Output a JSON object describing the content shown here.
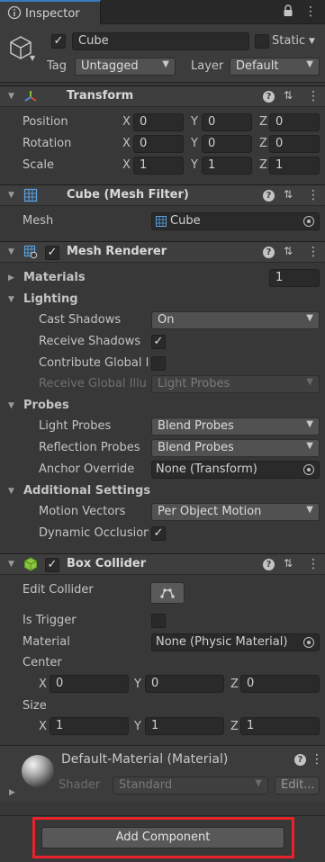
{
  "tab": {
    "title": "Inspector"
  },
  "gameobject": {
    "active": true,
    "name": "Cube",
    "static_label": "Static",
    "static": false,
    "tag_label": "Tag",
    "tag_value": "Untagged",
    "layer_label": "Layer",
    "layer_value": "Default"
  },
  "transform": {
    "title": "Transform",
    "rows": [
      {
        "label": "Position",
        "x": "0",
        "y": "0",
        "z": "0"
      },
      {
        "label": "Rotation",
        "x": "0",
        "y": "0",
        "z": "0"
      },
      {
        "label": "Scale",
        "x": "1",
        "y": "1",
        "z": "1"
      }
    ]
  },
  "mesh_filter": {
    "title": "Cube (Mesh Filter)",
    "mesh_label": "Mesh",
    "mesh_value": "Cube"
  },
  "mesh_renderer": {
    "title": "Mesh Renderer",
    "enabled": true,
    "materials_label": "Materials",
    "materials_count": "1",
    "lighting_label": "Lighting",
    "cast_shadows_label": "Cast Shadows",
    "cast_shadows_value": "On",
    "receive_shadows_label": "Receive Shadows",
    "receive_shadows": true,
    "contribute_gi_label": "Contribute Global I",
    "contribute_gi": false,
    "receive_gi_label": "Receive Global Illu",
    "receive_gi_value": "Light Probes",
    "probes_label": "Probes",
    "light_probes_label": "Light Probes",
    "light_probes_value": "Blend Probes",
    "reflection_probes_label": "Reflection Probes",
    "reflection_probes_value": "Blend Probes",
    "anchor_override_label": "Anchor Override",
    "anchor_override_value": "None (Transform)",
    "additional_label": "Additional Settings",
    "motion_vectors_label": "Motion Vectors",
    "motion_vectors_value": "Per Object Motion",
    "dynamic_occlusion_label": "Dynamic Occlusion",
    "dynamic_occlusion": true
  },
  "box_collider": {
    "title": "Box Collider",
    "enabled": true,
    "edit_collider_label": "Edit Collider",
    "is_trigger_label": "Is Trigger",
    "is_trigger": false,
    "material_label": "Material",
    "material_value": "None (Physic Material)",
    "center_label": "Center",
    "center": {
      "x": "0",
      "y": "0",
      "z": "0"
    },
    "size_label": "Size",
    "size": {
      "x": "1",
      "y": "1",
      "z": "1"
    }
  },
  "material": {
    "title": "Default-Material (Material)",
    "shader_label": "Shader",
    "shader_value": "Standard",
    "edit_label": "Edit..."
  },
  "add_component_label": "Add Component",
  "axis_labels": {
    "x": "X",
    "y": "Y",
    "z": "Z"
  },
  "icon_names": [
    "lock-icon",
    "more-icon",
    "cube-icon",
    "transform-icon",
    "mesh-filter-icon",
    "mesh-renderer-icon",
    "box-collider-icon",
    "help-icon",
    "settings-icon",
    "menu-icon",
    "object-picker-icon",
    "edit-collider-icon",
    "material-sphere-icon"
  ],
  "colors": {
    "highlight": "#e8222b",
    "tab_accent": "#3a79bb",
    "panel_bg": "#383838"
  }
}
